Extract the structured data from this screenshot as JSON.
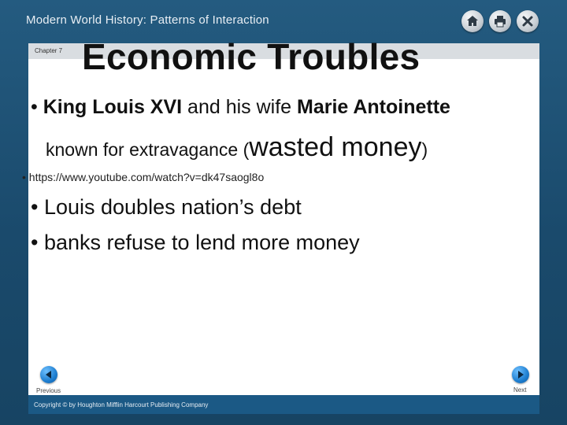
{
  "header": {
    "title": "Modern World History: Patterns of Interaction"
  },
  "toolbar": {
    "icons": [
      "home-icon",
      "print-icon",
      "close-icon"
    ]
  },
  "slide": {
    "chapter": "Chapter 7",
    "title": "Economic Troubles",
    "bullets": {
      "b1_prefix": "• ",
      "b1_bold1": "King Louis XVI",
      "b1_mid": " and his wife ",
      "b1_bold2": "Marie Antoinette",
      "b1_cont_pre": "known for extravagance (",
      "b1_cont_big": "wasted money",
      "b1_cont_post": ")",
      "b2": "•  https://www.youtube.com/watch?v=dk47saogl8o",
      "b3": "• Louis doubles nation’s debt",
      "b4": "• banks refuse to lend more money"
    }
  },
  "navigation": {
    "previous_label": "Previous",
    "next_label": "Next"
  },
  "footer": {
    "copyright": "Copyright © by Houghton Mifflin Harcourt Publishing Company"
  },
  "colors": {
    "background": "#1c4f72",
    "footer": "#1b5985",
    "nav_button": "#1e7ed0"
  }
}
